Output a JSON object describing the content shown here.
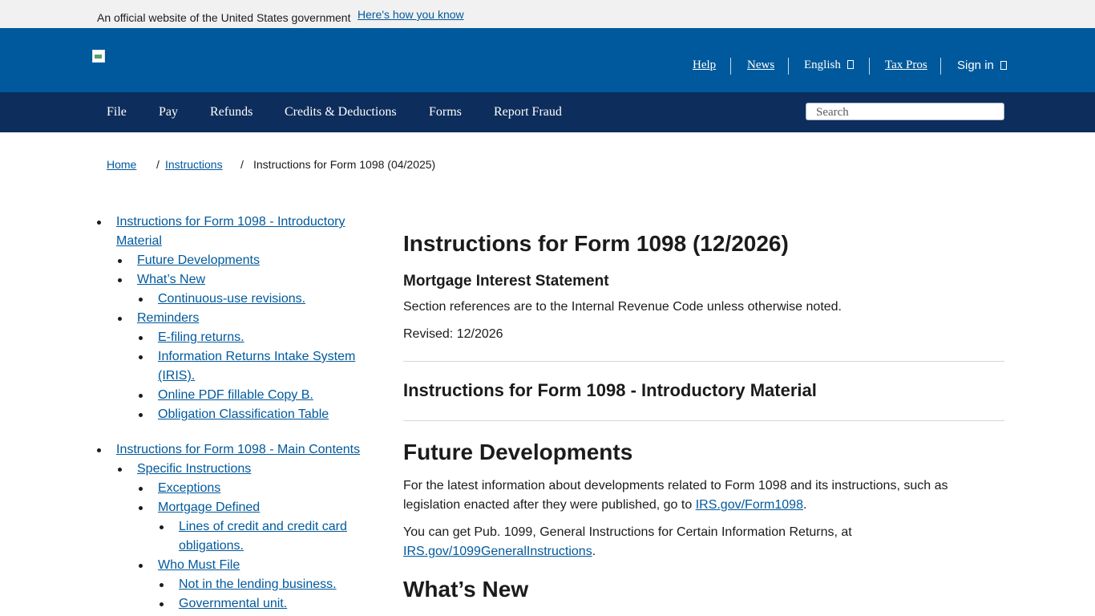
{
  "gov_banner": {
    "official_text": "An official website of the United States government",
    "how_link": "Here's how you know"
  },
  "header": {
    "utility": [
      {
        "label": "Help"
      },
      {
        "label": "News"
      },
      {
        "label": "English",
        "icon": "dropdown-icon"
      },
      {
        "label": "Tax Pros"
      },
      {
        "label": "Sign in",
        "icon": "dropdown-icon"
      }
    ]
  },
  "nav": {
    "items": [
      "File",
      "Pay",
      "Refunds",
      "Credits & Deductions",
      "Forms",
      "Report Fraud"
    ],
    "search_placeholder": "Search"
  },
  "breadcrumb": {
    "home": "Home",
    "instructions": "Instructions",
    "current": "Instructions for Form 1098 (04/2025)",
    "separator": "/"
  },
  "toc": {
    "intro": {
      "title_line1": "Instructions for Form 1098 - Introductory",
      "title_line2": "Material",
      "future": "Future Developments",
      "whats_new": "What’s New",
      "continuous": "Continuous-use revisions.",
      "reminders": "Reminders",
      "efiling": "E-filing returns.",
      "iris_line1": "Information Returns Intake System",
      "iris_line2": "(IRIS).",
      "online_pdf": "Online PDF fillable Copy B.",
      "obligation": "Obligation Classification Table"
    },
    "main": {
      "title": "Instructions for Form 1098 - Main Contents",
      "specific": "Specific Instructions",
      "exceptions": "Exceptions",
      "mortgage_defined": "Mortgage Defined",
      "lines_line1": "Lines of credit and credit card",
      "lines_line2": "obligations.",
      "who_must_file": "Who Must File",
      "not_lending": "Not in the lending business.",
      "governmental": "Governmental unit."
    }
  },
  "content": {
    "title": "Instructions for Form 1098 (12/2026)",
    "subtitle": "Mortgage Interest Statement",
    "section_refs": "Section references are to the Internal Revenue Code unless otherwise noted.",
    "revised": "Revised: 12/2026",
    "intro_heading": "Instructions for Form 1098 - Introductory Material",
    "future_heading": "Future Developments",
    "future_p1_line1": "For the latest information about developments related to Form 1098 and its instructions, such as",
    "future_p1_line2_prefix": "legislation enacted after they were published, go to ",
    "future_p1_link": "IRS.gov/Form1098",
    "future_p2_line1": "You can get Pub. 1099, General Instructions for Certain Information Returns, at",
    "future_p2_link": "IRS.gov/1099GeneralInstructions",
    "period": ".",
    "whats_new_heading": "What’s New"
  }
}
